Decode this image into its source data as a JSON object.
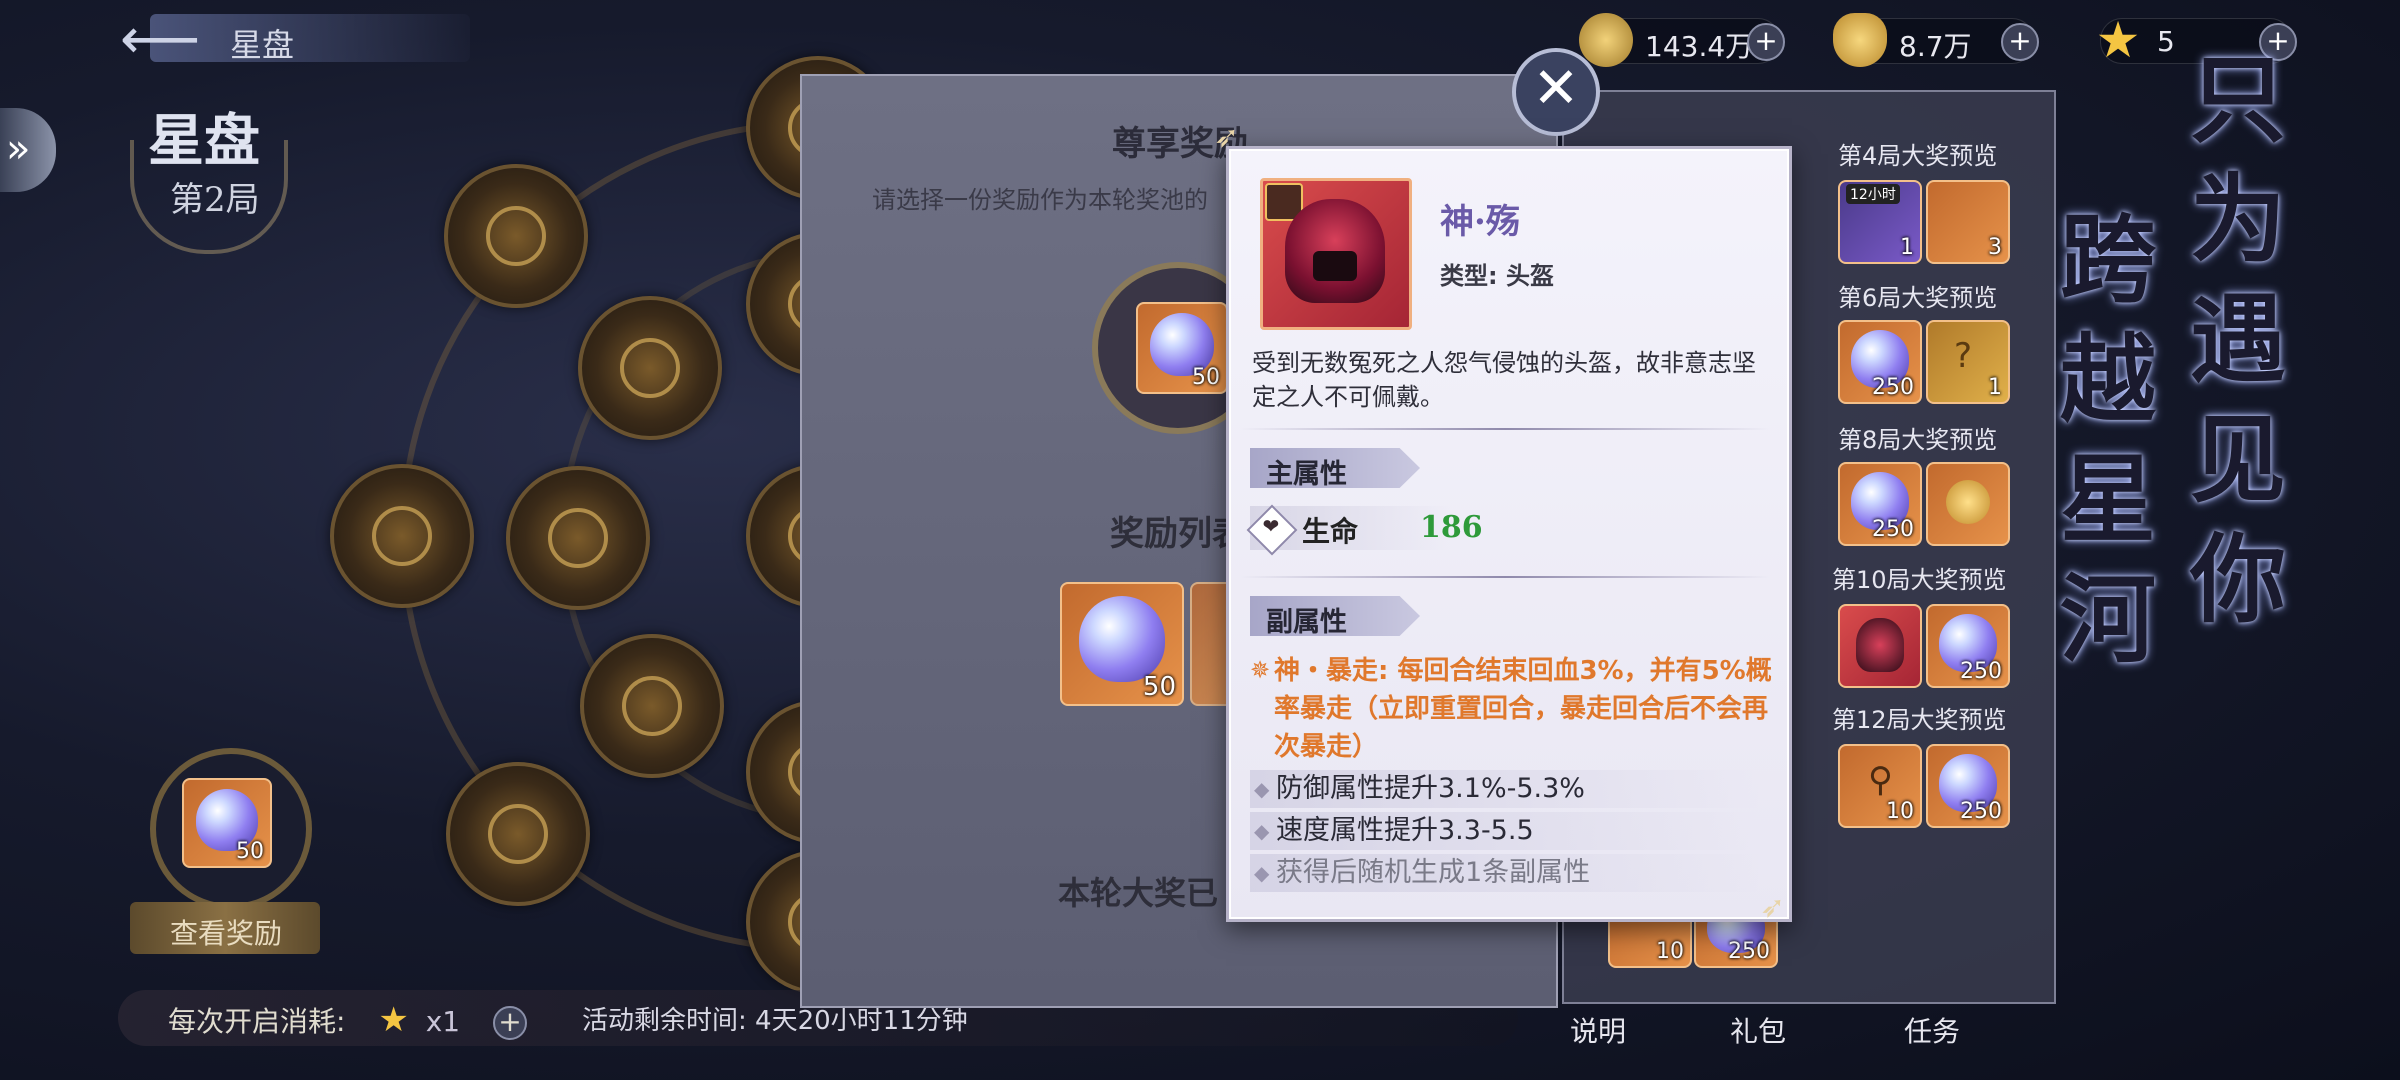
{
  "header": {
    "back_label": "星盘",
    "resources": [
      {
        "name": "coin",
        "value": "143.4万",
        "color": "#d8b25a"
      },
      {
        "name": "gold-ingot",
        "value": "8.7万",
        "color": "#e0b04a"
      },
      {
        "name": "star",
        "value": "5",
        "color": "#f4c542"
      }
    ]
  },
  "left": {
    "title": "星盘",
    "round": "第2局",
    "reward_count": "50",
    "view_rewards": "查看奖励",
    "cost_label": "每次开启消耗:",
    "cost_amount": "x1",
    "timer": "活动剩余时间: 4天20小时11分钟"
  },
  "panel": {
    "title": "尊享奖励",
    "subtitle": "请选择一份奖励作为本轮奖池的",
    "selected_count": "50",
    "list_title": "奖励列表",
    "list_count": "50",
    "bottom_text": "本轮大奖已"
  },
  "right_column": {
    "previews": [
      {
        "title": "第4局大奖预览",
        "items": [
          {
            "icon": "treasure-chest",
            "tag": "12小时",
            "count": "1"
          },
          {
            "icon": "lantern-staff",
            "count": "3"
          }
        ]
      },
      {
        "title": "第6局大奖预览",
        "items": [
          {
            "icon": "crystal-gem",
            "count": "250"
          },
          {
            "icon": "mystery-box",
            "count": "1"
          }
        ]
      },
      {
        "title": "第8局大奖预览",
        "items": [
          {
            "icon": "crystal-gem",
            "count": "250"
          },
          {
            "icon": "golden-ornament",
            "count": ""
          }
        ]
      },
      {
        "title": "第10局大奖预览",
        "items": [
          {
            "icon": "demon-helmet",
            "count": ""
          },
          {
            "icon": "crystal-gem",
            "count": "250"
          }
        ]
      },
      {
        "title": "第12局大奖预览",
        "items": [
          {
            "icon": "lantern-staff",
            "count": "10"
          },
          {
            "icon": "crystal-gem",
            "count": "250"
          }
        ]
      }
    ],
    "bottom_items": [
      {
        "icon": "lantern-staff",
        "count": "10"
      },
      {
        "icon": "crystal-gem",
        "count": "250"
      }
    ],
    "nav": [
      "说明",
      "礼包",
      "任务"
    ],
    "calligraphy_left": "跨越星河",
    "calligraphy_right": "只为遇见你"
  },
  "tooltip": {
    "name": "神·殇",
    "type": "类型: 头盔",
    "description": "受到无数冤死之人怨气侵蚀的头盔，故非意志坚定之人不可佩戴。",
    "main_attr_title": "主属性",
    "main_attr": {
      "name": "生命",
      "value": "186"
    },
    "sub_attr_title": "副属性",
    "skill": "神・暴走: 每回合结束回血3%，并有5%概率暴走（立即重置回合，暴走回合后不会再次暴走）",
    "sub_attrs": [
      {
        "text": "防御属性提升3.1%-5.3%",
        "color": "#2a2a36"
      },
      {
        "text": "速度属性提升3.3-5.5",
        "color": "#2a2a36"
      },
      {
        "text": "获得后随机生成1条副属性",
        "color": "#7a7a88"
      }
    ],
    "accent_color": "#e0782c",
    "value_color": "#2e9a3a"
  }
}
